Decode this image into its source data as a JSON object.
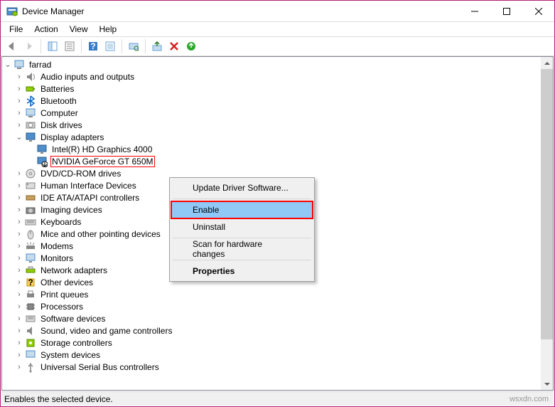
{
  "window": {
    "title": "Device Manager"
  },
  "menubar": {
    "file": "File",
    "action": "Action",
    "view": "View",
    "help": "Help"
  },
  "tree": {
    "root": "farrad",
    "items": [
      "Audio inputs and outputs",
      "Batteries",
      "Bluetooth",
      "Computer",
      "Disk drives",
      "Display adapters",
      "Intel(R) HD Graphics 4000",
      "NVIDIA GeForce GT 650M",
      "DVD/CD-ROM drives",
      "Human Interface Devices",
      "IDE ATA/ATAPI controllers",
      "Imaging devices",
      "Keyboards",
      "Mice and other pointing devices",
      "Modems",
      "Monitors",
      "Network adapters",
      "Other devices",
      "Print queues",
      "Processors",
      "Software devices",
      "Sound, video and game controllers",
      "Storage controllers",
      "System devices",
      "Universal Serial Bus controllers"
    ]
  },
  "context_menu": {
    "update": "Update Driver Software...",
    "enable": "Enable",
    "uninstall": "Uninstall",
    "scan": "Scan for hardware changes",
    "properties": "Properties"
  },
  "statusbar": {
    "text": "Enables the selected device."
  },
  "watermark": "wsxdn.com"
}
